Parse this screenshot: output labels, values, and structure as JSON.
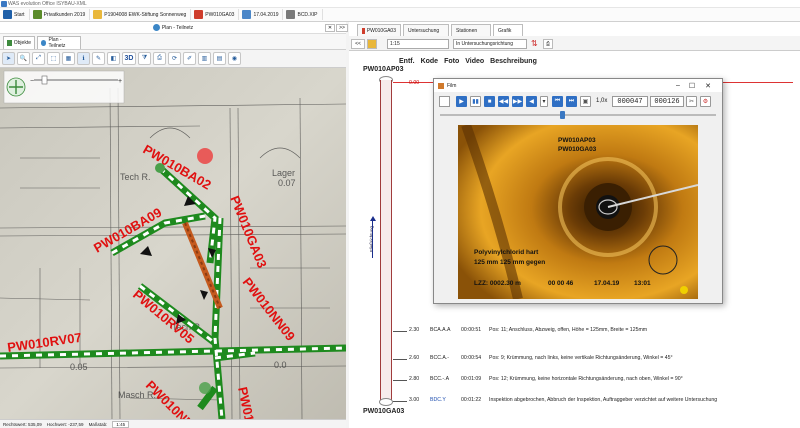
{
  "window_title": "WAS evolution Office ISYBAU-XML",
  "taskbar": [
    {
      "label": "Start",
      "icon": "start-icon",
      "color": "#1e5fa8"
    },
    {
      "label": "Privatkunden 2019",
      "icon": "user-icon",
      "color": "#5b8c2a"
    },
    {
      "label": "P1904008 EWK-Stiftung Sonnenweg",
      "icon": "folder-icon",
      "color": "#e9b73a"
    },
    {
      "label": "PW010GA03",
      "icon": "pipe-icon",
      "color": "#cf3d2c"
    },
    {
      "label": "17.04.2019",
      "icon": "calendar-icon",
      "color": "#4a86c8"
    },
    {
      "label": "BCD.XIP",
      "icon": "file-icon",
      "color": "#7a7a7a"
    }
  ],
  "left": {
    "title": "Plan - Teilnetz",
    "tabs": [
      "Objekte",
      "Plan - Teilnetz"
    ],
    "toolbar_3d": "3D",
    "map_labels": [
      {
        "text": "PW010BA02"
      },
      {
        "text": "PW010BA09"
      },
      {
        "text": "PW010GA03"
      },
      {
        "text": "PW010NN09"
      },
      {
        "text": "PW010RV05"
      },
      {
        "text": "PW010RV07"
      },
      {
        "text": "PW010NN"
      },
      {
        "text": "PW010RV"
      }
    ],
    "plan_text": [
      "Tech R.",
      "Lager",
      "0.07",
      "Tech R.",
      "Masch R.",
      "0.05",
      "0.0"
    ],
    "status": {
      "rechtswert": "Rechtswert: 535,09",
      "hochwert": "Hochwert: -237,59",
      "massstab_label": "Maßstab:",
      "massstab": "1:45"
    }
  },
  "right": {
    "tabs": [
      "PW010GA03",
      "Untersuchung",
      "Stationen",
      "Grafik"
    ],
    "scale": "1:15",
    "direction": "In Untersuchungsrichtung",
    "nav_prev": "<<",
    "nav_top": ">>",
    "headers": [
      "Entf.",
      "Kode",
      "Foto",
      "Video",
      "Beschreibung"
    ],
    "pipe_start": "PW010AP03",
    "pipe_end": "PW010GA03",
    "flow_label": "Fließrichtung",
    "events": [
      {
        "dist": "0.00",
        "code": "",
        "time": "",
        "desc": ""
      },
      {
        "dist": "2.30",
        "code": "BCA.A.A",
        "time": "00:00:51",
        "desc": "Pos: 11; Anschluss, Abzweig, offen, Höhe = 125mm, Breite = 125mm"
      },
      {
        "dist": "2.60",
        "code": "BCC.A.-",
        "time": "00:00:54",
        "desc": "Pos: 9; Krümmung, nach links, keine vertikale Richtungsänderung, Winkel = 45°"
      },
      {
        "dist": "2.80",
        "code": "BCC.-.A",
        "time": "00:01:09",
        "desc": "Pos: 12; Krümmung, keine horizontale Richtungsänderung, nach oben, Winkel = 90°"
      },
      {
        "dist": "3.00",
        "code": "BDC.Y",
        "time": "00:01:22",
        "desc": "Inspektion abgebrochen, Abbruch der Inspektion, Auftraggeber verzichtet auf weitere Untersuchung"
      }
    ]
  },
  "film": {
    "title": "Film",
    "speed": "1,0x",
    "frame": "000047",
    "frame2": "000126",
    "overlay": {
      "line1": "PW010AP03",
      "line2": "PW010GA03",
      "material": "Polyvinylchlorid hart",
      "dims": "125 mm     125 mm     gegen",
      "lzz": "LZZ:  0002.30 m",
      "time": "00 00 46",
      "date": "17.04.19",
      "clock": "13:01"
    }
  }
}
